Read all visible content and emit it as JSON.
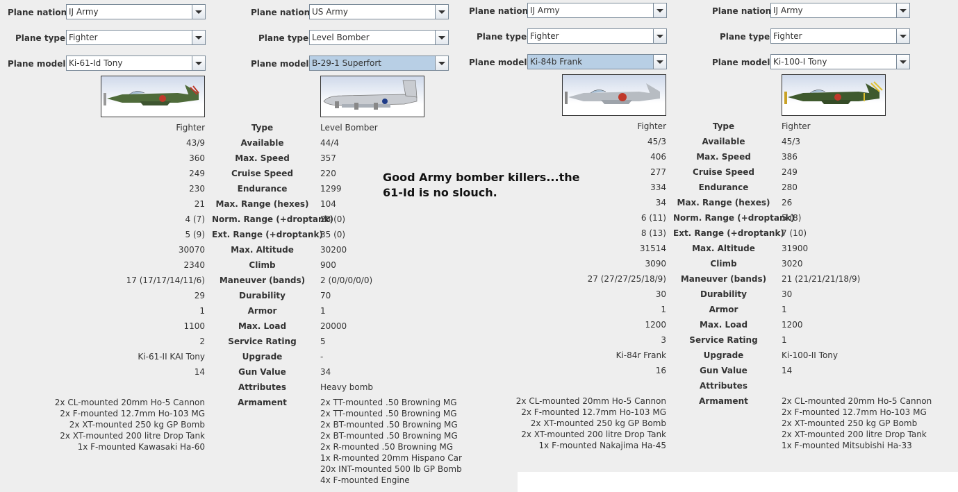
{
  "labels": {
    "nation": "Plane nation:",
    "type": "Plane type:",
    "model": "Plane model:"
  },
  "stat_labels": [
    "Type",
    "Available",
    "Max. Speed",
    "Cruise Speed",
    "Endurance",
    "Max. Range (hexes)",
    "Norm. Range (+droptank)",
    "Ext. Range (+droptank)",
    "Max. Altitude",
    "Climb",
    "Maneuver (bands)",
    "Durability",
    "Armor",
    "Max. Load",
    "Service Rating",
    "Upgrade",
    "Gun Value",
    "Attributes",
    "Armament"
  ],
  "left_panel": {
    "plane_a": {
      "nation": "IJ Army",
      "type": "Fighter",
      "model": "Ki-61-Id Tony",
      "stats": [
        "Fighter",
        "43/9",
        "360",
        "249",
        "230",
        "21",
        "4 (7)",
        "5 (9)",
        "30070",
        "2340",
        "17 (17/17/14/11/6)",
        "29",
        "1",
        "1100",
        "2",
        "Ki-61-II KAI Tony",
        "14",
        ""
      ],
      "armament": [
        "2x CL-mounted 20mm Ho-5 Cannon",
        "2x F-mounted 12.7mm Ho-103 MG",
        "2x XT-mounted 250 kg GP Bomb",
        "2x XT-mounted 200 litre Drop Tank",
        "1x F-mounted Kawasaki Ha-60"
      ]
    },
    "plane_b": {
      "nation": "US Army",
      "type": "Level Bomber",
      "model": "B-29-1 Superfort",
      "stats": [
        "Level Bomber",
        "44/4",
        "357",
        "220",
        "1299",
        "104",
        "28 (0)",
        "35 (0)",
        "30200",
        "900",
        "2 (0/0/0/0/0)",
        "70",
        "1",
        "20000",
        "5",
        "-",
        "34",
        "Heavy bomb"
      ],
      "armament": [
        "2x TT-mounted .50 Browning MG",
        "2x TT-mounted .50 Browning MG",
        "2x BT-mounted .50 Browning MG",
        "2x BT-mounted .50 Browning MG",
        "2x R-mounted .50 Browning MG",
        "1x R-mounted 20mm Hispano Car",
        "20x INT-mounted 500 lb GP Bomb",
        "4x F-mounted Engine"
      ]
    }
  },
  "right_panel": {
    "plane_a": {
      "nation": "IJ Army",
      "type": "Fighter",
      "model": "Ki-84b Frank",
      "stats": [
        "Fighter",
        "45/3",
        "406",
        "277",
        "334",
        "34",
        "6 (11)",
        "8 (13)",
        "31514",
        "3090",
        "27 (27/27/25/18/9)",
        "30",
        "1",
        "1200",
        "3",
        "Ki-84r Frank",
        "16",
        ""
      ],
      "armament": [
        "2x CL-mounted 20mm Ho-5 Cannon",
        "2x F-mounted 12.7mm Ho-103 MG",
        "2x XT-mounted 250 kg GP Bomb",
        "2x XT-mounted 200 litre Drop Tank",
        "1x F-mounted Nakajima Ha-45"
      ]
    },
    "plane_b": {
      "nation": "IJ Army",
      "type": "Fighter",
      "model": "Ki-100-I Tony",
      "stats": [
        "Fighter",
        "45/3",
        "386",
        "249",
        "280",
        "26",
        "5 (8)",
        "7 (10)",
        "31900",
        "3020",
        "21 (21/21/21/18/9)",
        "30",
        "1",
        "1200",
        "1",
        "Ki-100-II Tony",
        "14",
        ""
      ],
      "armament": [
        "2x CL-mounted 20mm Ho-5 Cannon",
        "2x F-mounted 12.7mm Ho-103 MG",
        "2x XT-mounted 250 kg GP Bomb",
        "2x XT-mounted 200 litre Drop Tank",
        "1x F-mounted Mitsubishi Ha-33"
      ]
    }
  },
  "note": "Good Army bomber killers...the 61-Id is no slouch.",
  "colors": {
    "background": "#eeeeee",
    "selected_combo": "#b8cfe5",
    "combo_border": "#7a8a99"
  }
}
